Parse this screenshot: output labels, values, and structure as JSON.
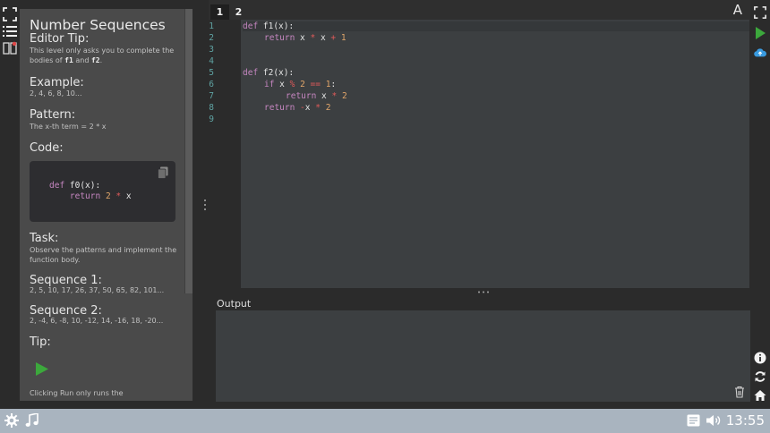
{
  "panel": {
    "title": "Number Sequences",
    "editor_tip_heading": "Editor Tip:",
    "editor_tip_text_a": "This level only asks you to complete the bodies of ",
    "editor_tip_f1": "f1",
    "editor_tip_and": " and ",
    "editor_tip_f2": "f2",
    "editor_tip_end": ".",
    "example_heading": "Example:",
    "example_text": "2, 4, 6, 8, 10...",
    "pattern_heading": "Pattern:",
    "pattern_text": "The x-th term = 2 * x",
    "code_heading": "Code:",
    "code_line1_kw": "def",
    "code_line1_rest": " f0(x):",
    "code_line2_kw": "return",
    "code_line2_num": " 2",
    "code_line2_op": " *",
    "code_line2_rest": " x",
    "task_heading": "Task:",
    "task_text": "Observe the patterns and implement the function body.",
    "seq1_heading": "Sequence 1:",
    "seq1_text": "2, 5, 10, 17, 26, 37, 50, 65, 82, 101...",
    "seq2_heading": "Sequence 2:",
    "seq2_text": "2, -4, 6, -8, 10, -12, 14, -16, 18, -20...",
    "tip_heading": "Tip:",
    "tip_text": "Clicking Run only runs the"
  },
  "editor": {
    "tabs": [
      "1",
      "2"
    ],
    "font_button": "A",
    "line_numbers": [
      "1",
      "2",
      "3",
      "4",
      "5",
      "6",
      "7",
      "8",
      "9"
    ],
    "code": {
      "l1_kw": "def",
      "l1_rest": " f1(x):",
      "l2_kw": "return",
      "l2_a": " x",
      "l2_op1": " *",
      "l2_b": " x",
      "l2_op2": " +",
      "l2_num": " 1",
      "l5_kw": "def",
      "l5_rest": " f2(x):",
      "l6_kw": "if",
      "l6_a": " x",
      "l6_op1": " %",
      "l6_num1": " 2",
      "l6_op2": " ==",
      "l6_num2": " 1",
      "l6_colon": ":",
      "l7_kw": "return",
      "l7_a": " x",
      "l7_op": " *",
      "l7_num": " 2",
      "l8_kw": "return",
      "l8_op1": " -",
      "l8_a": "x",
      "l8_op2": " *",
      "l8_num": " 2"
    }
  },
  "output": {
    "label": "Output"
  },
  "status": {
    "clock": "13:55"
  },
  "colors": {
    "run_green": "#3ca83c",
    "cloud_blue": "#3a9be0",
    "bottom_bar": "#a9b4bf"
  }
}
